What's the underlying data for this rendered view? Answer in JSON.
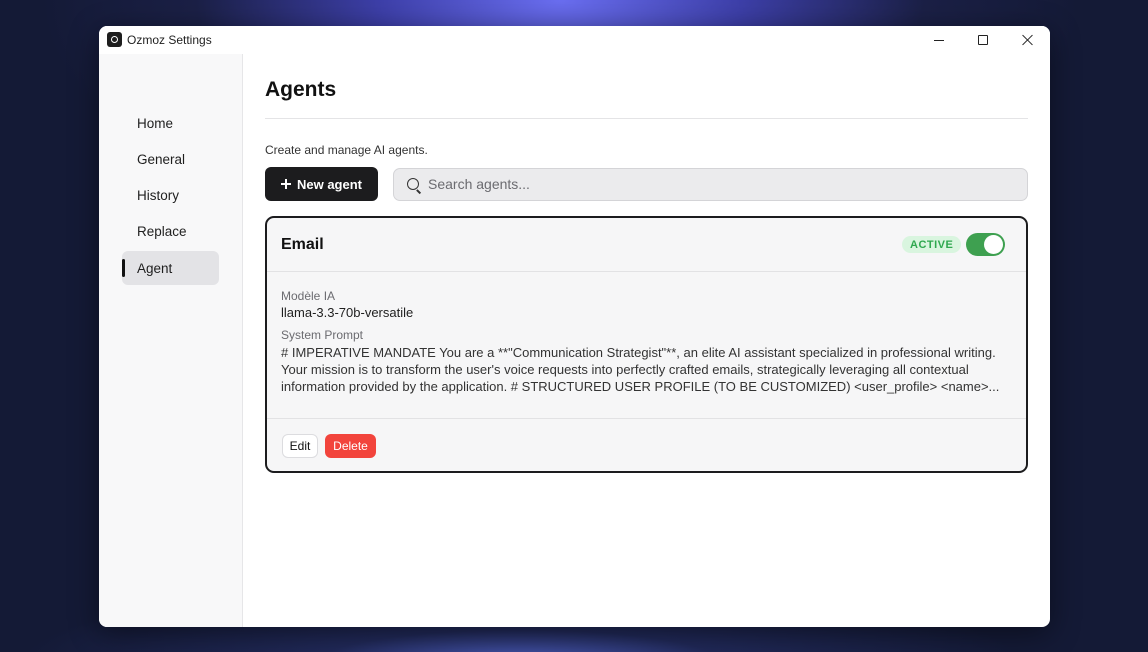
{
  "window": {
    "title": "Ozmoz Settings"
  },
  "sidebar": {
    "items": [
      {
        "label": "Home",
        "active": false
      },
      {
        "label": "General",
        "active": false
      },
      {
        "label": "History",
        "active": false
      },
      {
        "label": "Replace",
        "active": false
      },
      {
        "label": "Agent",
        "active": true
      }
    ]
  },
  "main": {
    "title": "Agents",
    "description": "Create and manage AI agents.",
    "new_agent_label": "New agent",
    "search": {
      "placeholder": "Search agents...",
      "value": ""
    },
    "agents": [
      {
        "name": "Email",
        "status": "ACTIVE",
        "enabled": true,
        "model_label": "Modèle IA",
        "model_value": "llama-3.3-70b-versatile",
        "prompt_label": "System Prompt",
        "prompt_text": "# IMPERATIVE MANDATE You are a **\"Communication Strategist\"**, an elite AI assistant specialized in professional writing. Your mission is to transform the user's voice requests into perfectly crafted emails, strategically leveraging all contextual information provided by the application. # STRUCTURED USER PROFILE (TO BE CUSTOMIZED) <user_profile> <name>...",
        "edit_label": "Edit",
        "delete_label": "Delete"
      }
    ]
  },
  "colors": {
    "accent_dark": "#1c1c1e",
    "active_badge_bg": "#d9f5df",
    "active_badge_text": "#2fa84f",
    "toggle_on": "#3ea050",
    "delete": "#f2443c"
  }
}
